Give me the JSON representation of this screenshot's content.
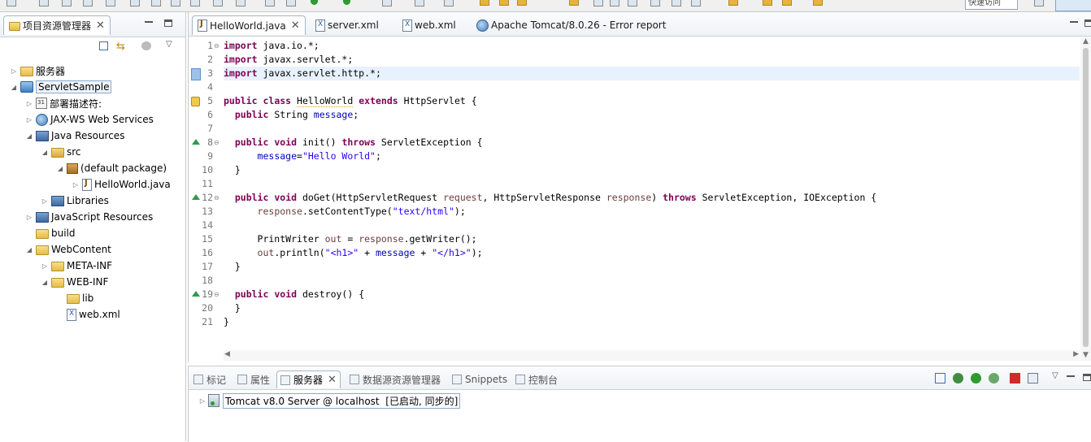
{
  "toolbar": {
    "quick_access_placeholder": "快速访问"
  },
  "project_explorer": {
    "tab_label": "项目资源管理器",
    "tree": [
      {
        "label": "服务器",
        "depth": 0,
        "twisty": "closed",
        "icon": "folder-icon"
      },
      {
        "label": "ServletSample",
        "depth": 0,
        "twisty": "open",
        "icon": "project-icon",
        "selected": true
      },
      {
        "label": "部署描述符:",
        "depth": 1,
        "twisty": "closed",
        "icon": "deployment-descriptor-icon"
      },
      {
        "label": "JAX-WS Web Services",
        "depth": 1,
        "twisty": "closed",
        "icon": "web-services-icon"
      },
      {
        "label": "Java Resources",
        "depth": 1,
        "twisty": "open",
        "icon": "java-resources-icon"
      },
      {
        "label": "src",
        "depth": 2,
        "twisty": "open",
        "icon": "source-folder-icon"
      },
      {
        "label": "(default package)",
        "depth": 3,
        "twisty": "open",
        "icon": "package-icon"
      },
      {
        "label": "HelloWorld.java",
        "depth": 4,
        "twisty": "closed",
        "icon": "java-file-icon"
      },
      {
        "label": "Libraries",
        "depth": 2,
        "twisty": "closed",
        "icon": "libraries-icon"
      },
      {
        "label": "JavaScript Resources",
        "depth": 1,
        "twisty": "closed",
        "icon": "javascript-resources-icon"
      },
      {
        "label": "build",
        "depth": 1,
        "twisty": "none",
        "icon": "folder-icon"
      },
      {
        "label": "WebContent",
        "depth": 1,
        "twisty": "open",
        "icon": "folder-icon"
      },
      {
        "label": "META-INF",
        "depth": 2,
        "twisty": "closed",
        "icon": "folder-icon"
      },
      {
        "label": "WEB-INF",
        "depth": 2,
        "twisty": "open",
        "icon": "folder-icon"
      },
      {
        "label": "lib",
        "depth": 3,
        "twisty": "none",
        "icon": "folder-icon"
      },
      {
        "label": "web.xml",
        "depth": 3,
        "twisty": "none",
        "icon": "xml-file-icon"
      }
    ]
  },
  "editor": {
    "tabs": [
      {
        "label": "HelloWorld.java",
        "active": true,
        "closable": true
      },
      {
        "label": "server.xml",
        "active": false
      },
      {
        "label": "web.xml",
        "active": false
      },
      {
        "label": "Apache Tomcat/8.0.26 - Error report",
        "active": false
      }
    ],
    "lines": [
      {
        "n": "1",
        "fold": "minus",
        "html": "<span class=\"kw\">import</span> java.io.*;"
      },
      {
        "n": "2",
        "html": "<span class=\"kw\">import</span> javax.servlet.*;"
      },
      {
        "n": "3",
        "html": "<span class=\"kw\">import</span> javax.servlet.http.*;",
        "highlight": true
      },
      {
        "n": "4",
        "html": ""
      },
      {
        "n": "5",
        "html": "<span class=\"kw\">public</span> <span class=\"kw\">class</span> <span class=\"warn-ul\">HelloWorld</span> <span class=\"kw\">extends</span> HttpServlet {",
        "marker": "warning"
      },
      {
        "n": "6",
        "html": "  <span class=\"kw\">public</span> String <span class=\"fld\">message</span>;"
      },
      {
        "n": "7",
        "html": ""
      },
      {
        "n": "8",
        "fold": "minus",
        "marker": "override",
        "html": "  <span class=\"kw\">public</span> <span class=\"kw\">void</span> init() <span class=\"kw\">throws</span> ServletException {"
      },
      {
        "n": "9",
        "html": "      <span class=\"fld\">message</span>=<span class=\"str\">\"Hello World\"</span>;"
      },
      {
        "n": "10",
        "html": "  }"
      },
      {
        "n": "11",
        "html": ""
      },
      {
        "n": "12",
        "fold": "minus",
        "marker": "override",
        "html": "  <span class=\"kw\">public</span> <span class=\"kw\">void</span> doGet(HttpServletRequest <span class=\"par\">request</span>, HttpServletResponse <span class=\"par\">response</span>) <span class=\"kw\">throws</span> ServletException, IOException {"
      },
      {
        "n": "13",
        "html": "      <span class=\"par\">response</span>.setContentType(<span class=\"str\">\"text/html\"</span>);"
      },
      {
        "n": "14",
        "html": ""
      },
      {
        "n": "15",
        "html": "      PrintWriter <span class=\"par\">out</span> = <span class=\"par\">response</span>.getWriter();"
      },
      {
        "n": "16",
        "html": "      <span class=\"par\">out</span>.println(<span class=\"str\">\"&lt;h1&gt;\"</span> + <span class=\"fld\">message</span> + <span class=\"str\">\"&lt;/h1&gt;\"</span>);"
      },
      {
        "n": "17",
        "html": "  }"
      },
      {
        "n": "18",
        "html": ""
      },
      {
        "n": "19",
        "fold": "minus",
        "marker": "override",
        "html": "  <span class=\"kw\">public</span> <span class=\"kw\">void</span> destroy() {"
      },
      {
        "n": "20",
        "html": "  }"
      },
      {
        "n": "21",
        "html": "}"
      }
    ]
  },
  "bottom_panel": {
    "tabs": [
      {
        "label": "标记",
        "icon": "markers-icon"
      },
      {
        "label": "属性",
        "icon": "properties-icon"
      },
      {
        "label": "服务器",
        "icon": "servers-icon",
        "active": true,
        "closable": true
      },
      {
        "label": "数据源资源管理器",
        "icon": "data-source-icon"
      },
      {
        "label": "Snippets",
        "icon": "snippets-icon"
      },
      {
        "label": "控制台",
        "icon": "console-icon"
      }
    ],
    "server": {
      "name": "Tomcat v8.0 Server @ localhost",
      "status": "[已启动, 同步的]"
    }
  },
  "colors": {
    "keyword": "#7f0055",
    "string": "#2a00ff",
    "field": "#0000c0",
    "parameter": "#6a3e3e",
    "line_highlight": "#e8f2fe"
  }
}
